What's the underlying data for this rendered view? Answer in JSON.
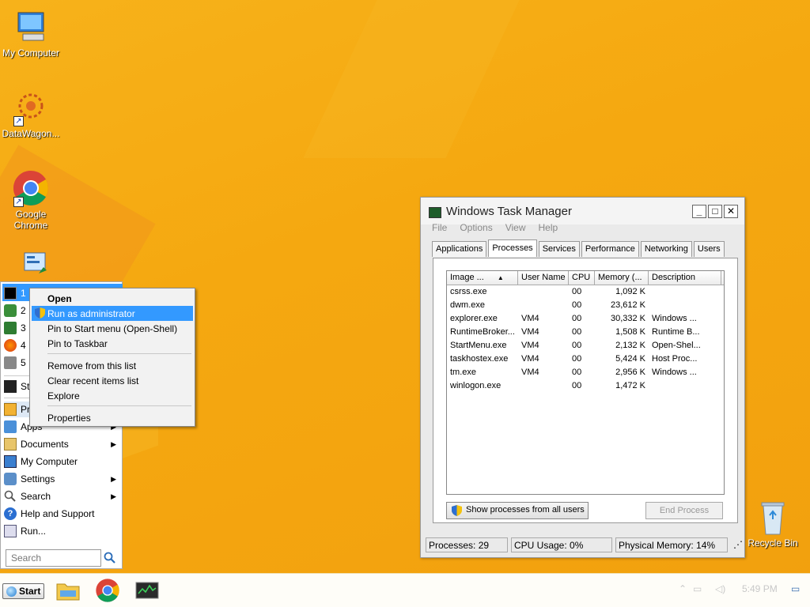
{
  "desktop": {
    "icons": [
      {
        "label": "My Computer",
        "icon": "computer-icon"
      },
      {
        "label": "DataWagon...",
        "icon": "datawagon-icon"
      },
      {
        "label": "Google Chrome",
        "icon": "chrome-icon"
      },
      {
        "label": "",
        "icon": "control-panel-icon"
      }
    ],
    "recycle_bin": "Recycle Bin"
  },
  "task_manager": {
    "title": "Windows Task Manager",
    "menu": [
      "File",
      "Options",
      "View",
      "Help"
    ],
    "tabs": [
      "Applications",
      "Processes",
      "Services",
      "Performance",
      "Networking",
      "Users"
    ],
    "active_tab": "Processes",
    "columns": [
      "Image ...",
      "User Name",
      "CPU",
      "Memory (...",
      "Description"
    ],
    "sort_indicator": "▲",
    "rows": [
      {
        "image": "csrss.exe",
        "user": "",
        "cpu": "00",
        "mem": "1,092 K",
        "desc": ""
      },
      {
        "image": "dwm.exe",
        "user": "",
        "cpu": "00",
        "mem": "23,612 K",
        "desc": ""
      },
      {
        "image": "explorer.exe",
        "user": "VM4",
        "cpu": "00",
        "mem": "30,332 K",
        "desc": "Windows ..."
      },
      {
        "image": "RuntimeBroker...",
        "user": "VM4",
        "cpu": "00",
        "mem": "1,508 K",
        "desc": "Runtime B..."
      },
      {
        "image": "StartMenu.exe",
        "user": "VM4",
        "cpu": "00",
        "mem": "2,132 K",
        "desc": "Open-Shel..."
      },
      {
        "image": "taskhostex.exe",
        "user": "VM4",
        "cpu": "00",
        "mem": "5,424 K",
        "desc": "Host Proc..."
      },
      {
        "image": "tm.exe",
        "user": "VM4",
        "cpu": "00",
        "mem": "2,956 K",
        "desc": "Windows ..."
      },
      {
        "image": "winlogon.exe",
        "user": "",
        "cpu": "00",
        "mem": "1,472 K",
        "desc": ""
      }
    ],
    "show_all_label": "Show processes from all users",
    "end_process_label": "End Process",
    "status": {
      "processes": "Processes: 29",
      "cpu": "CPU Usage: 0%",
      "memory": "Physical Memory: 14%"
    }
  },
  "start_menu": {
    "recent": [
      "1",
      "2",
      "3",
      "4",
      "5"
    ],
    "pinned": "St",
    "items": [
      {
        "label": "Pr",
        "has_arrow": false
      },
      {
        "label": "Apps",
        "has_arrow": true
      },
      {
        "label": "Documents",
        "has_arrow": true
      },
      {
        "label": "My Computer",
        "has_arrow": false
      },
      {
        "label": "Settings",
        "has_arrow": true
      },
      {
        "label": "Search",
        "has_arrow": true
      },
      {
        "label": "Help and Support",
        "has_arrow": false
      },
      {
        "label": "Run...",
        "has_arrow": false
      }
    ],
    "search_placeholder": "Search"
  },
  "context_menu": {
    "open": "Open",
    "run_admin": "Run as administrator",
    "pin_start": "Pin to Start menu (Open-Shell)",
    "pin_taskbar": "Pin to Taskbar",
    "remove": "Remove from this list",
    "clear": "Clear recent items list",
    "explore": "Explore",
    "properties": "Properties"
  },
  "taskbar": {
    "start_label": "Start",
    "tray_time": "5:49 PM"
  }
}
